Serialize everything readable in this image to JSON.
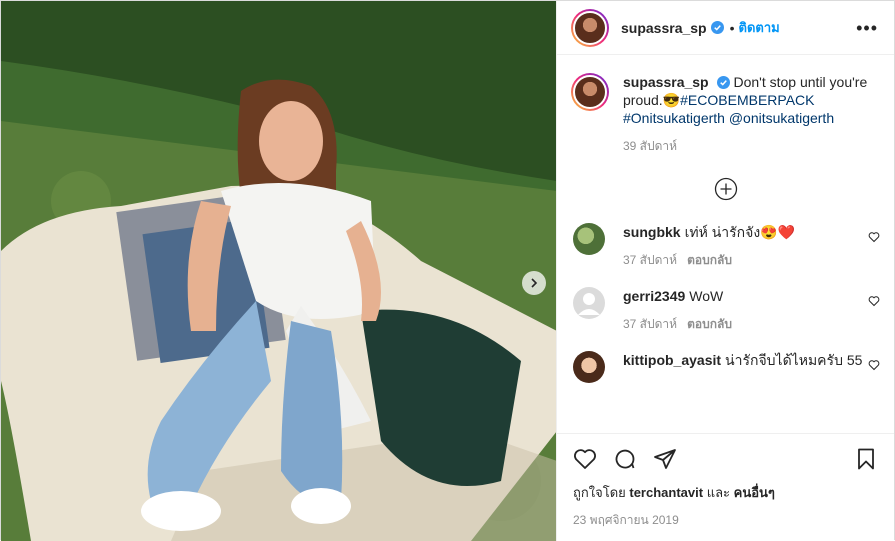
{
  "post": {
    "username": "supassra_sp",
    "follow_label": "ติดตาม",
    "dot": "•",
    "more_label": "•••"
  },
  "caption": {
    "username": "supassra_sp",
    "text_part1": "Don't stop until you're proud.",
    "emoji": "😎",
    "hashtag1": "#ECOBEMBERPACK",
    "hashtag2": "#Onitsukatigerth",
    "mention": "@onitsukatigerth",
    "time": "39 สัปดาห์"
  },
  "comments": [
    {
      "user": "sungbkk",
      "text": "เท่ห์ น่ารักจัง😍❤️",
      "time": "37 สัปดาห์",
      "reply": "ตอบกลับ",
      "avatar_color": "#6b8f4a"
    },
    {
      "user": "gerri2349",
      "text": "WoW",
      "time": "37 สัปดาห์",
      "reply": "ตอบกลับ",
      "avatar_color": "#dbdbdb"
    },
    {
      "user": "kittipob_ayasit",
      "text": "น่ารักจีบได้ไหมครับ 55",
      "avatar_color": "#c9875e"
    }
  ],
  "likes": {
    "prefix": "ถูกใจโดย",
    "user": "terchantavit",
    "conjunction": "และ",
    "others": "คนอื่นๆ"
  },
  "date": "23 พฤศจิกายน 2019",
  "colors": {
    "link": "#00376b",
    "follow": "#0095f6",
    "verified": "#3897f0"
  }
}
